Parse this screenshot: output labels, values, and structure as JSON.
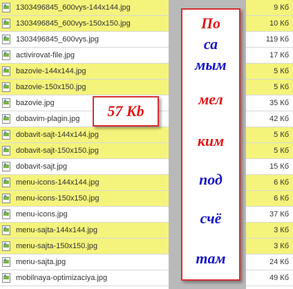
{
  "files": [
    {
      "name": "1303496845_600vys-144x144.jpg",
      "size": "9 Кб",
      "highlighted": true
    },
    {
      "name": "1303496845_600vys-150x150.jpg",
      "size": "10 Кб",
      "highlighted": true
    },
    {
      "name": "1303496845_600vys.jpg",
      "size": "119 Кб",
      "highlighted": false
    },
    {
      "name": "activirovat-file.jpg",
      "size": "17 Кб",
      "highlighted": false
    },
    {
      "name": "bazovie-144x144.jpg",
      "size": "5 Кб",
      "highlighted": true
    },
    {
      "name": "bazovie-150x150.jpg",
      "size": "5 Кб",
      "highlighted": true
    },
    {
      "name": "bazovie.jpg",
      "size": "35 Кб",
      "highlighted": false
    },
    {
      "name": "dobavim-plagin.jpg",
      "size": "42 Кб",
      "highlighted": false
    },
    {
      "name": "dobavit-sajt-144x144.jpg",
      "size": "5 Кб",
      "highlighted": true
    },
    {
      "name": "dobavit-sajt-150x150.jpg",
      "size": "5 Кб",
      "highlighted": true
    },
    {
      "name": "dobavit-sajt.jpg",
      "size": "15 Кб",
      "highlighted": false
    },
    {
      "name": "menu-icons-144x144.jpg",
      "size": "6 Кб",
      "highlighted": true
    },
    {
      "name": "menu-icons-150x150.jpg",
      "size": "6 Кб",
      "highlighted": true
    },
    {
      "name": "menu-icons.jpg",
      "size": "37 Кб",
      "highlighted": false
    },
    {
      "name": "menu-sajta-144x144.jpg",
      "size": "3 Кб",
      "highlighted": true
    },
    {
      "name": "menu-sajta-150x150.jpg",
      "size": "3 Кб",
      "highlighted": true
    },
    {
      "name": "menu-sajta.jpg",
      "size": "24 Кб",
      "highlighted": false
    },
    {
      "name": "mobilnaya-optimizaciya.jpg",
      "size": "49 Кб",
      "highlighted": false
    }
  ],
  "annotation_card": {
    "syllables": [
      {
        "text": "По",
        "color": "#e01818"
      },
      {
        "text": "са",
        "color": "#1717c8"
      },
      {
        "text": "мым",
        "color": "#1717c8"
      },
      {
        "text": "мел",
        "color": "#e01818"
      },
      {
        "text": "ким",
        "color": "#e01818"
      },
      {
        "text": "под",
        "color": "#1717c8"
      },
      {
        "text": "счё",
        "color": "#1717c8"
      },
      {
        "text": "там",
        "color": "#1717c8"
      }
    ]
  },
  "size_badge": {
    "text": "57 Kb"
  },
  "colors": {
    "highlight": "#f4f37b",
    "accent_red": "#d62f2f"
  }
}
